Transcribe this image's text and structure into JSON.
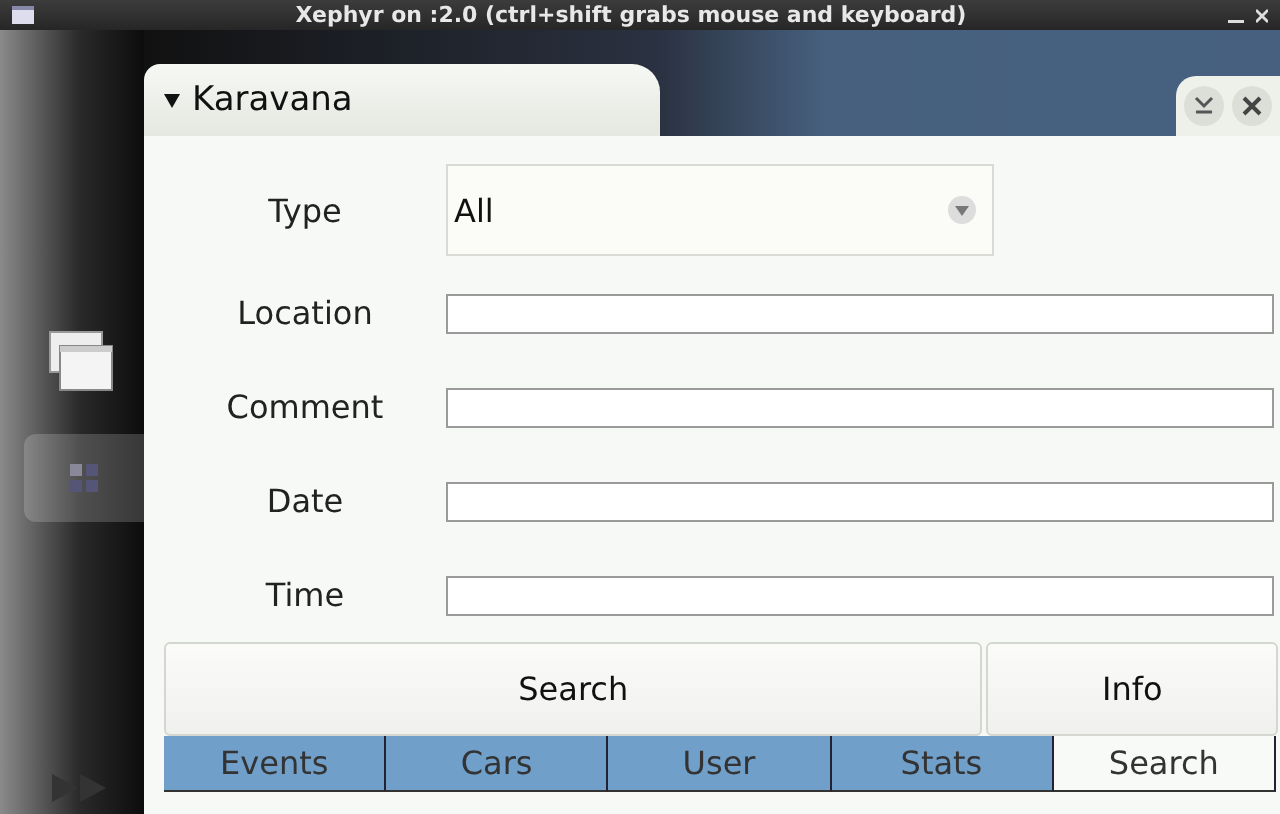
{
  "window": {
    "title": "Xephyr on :2.0 (ctrl+shift grabs mouse and keyboard)"
  },
  "app": {
    "title": "Karavana"
  },
  "form": [
    {
      "kind": "combo",
      "label": "Type",
      "value": "All"
    },
    {
      "kind": "text",
      "label": "Location"
    },
    {
      "kind": "text",
      "label": "Comment"
    },
    {
      "kind": "text",
      "label": "Date"
    },
    {
      "kind": "text",
      "label": "Time"
    }
  ],
  "buttons": [
    "Search",
    "Info"
  ],
  "tabs": [
    {
      "label": "Events",
      "selected": false
    },
    {
      "label": "Cars",
      "selected": false
    },
    {
      "label": "User",
      "selected": false
    },
    {
      "label": "Stats",
      "selected": false
    },
    {
      "label": "Search",
      "selected": true
    }
  ]
}
